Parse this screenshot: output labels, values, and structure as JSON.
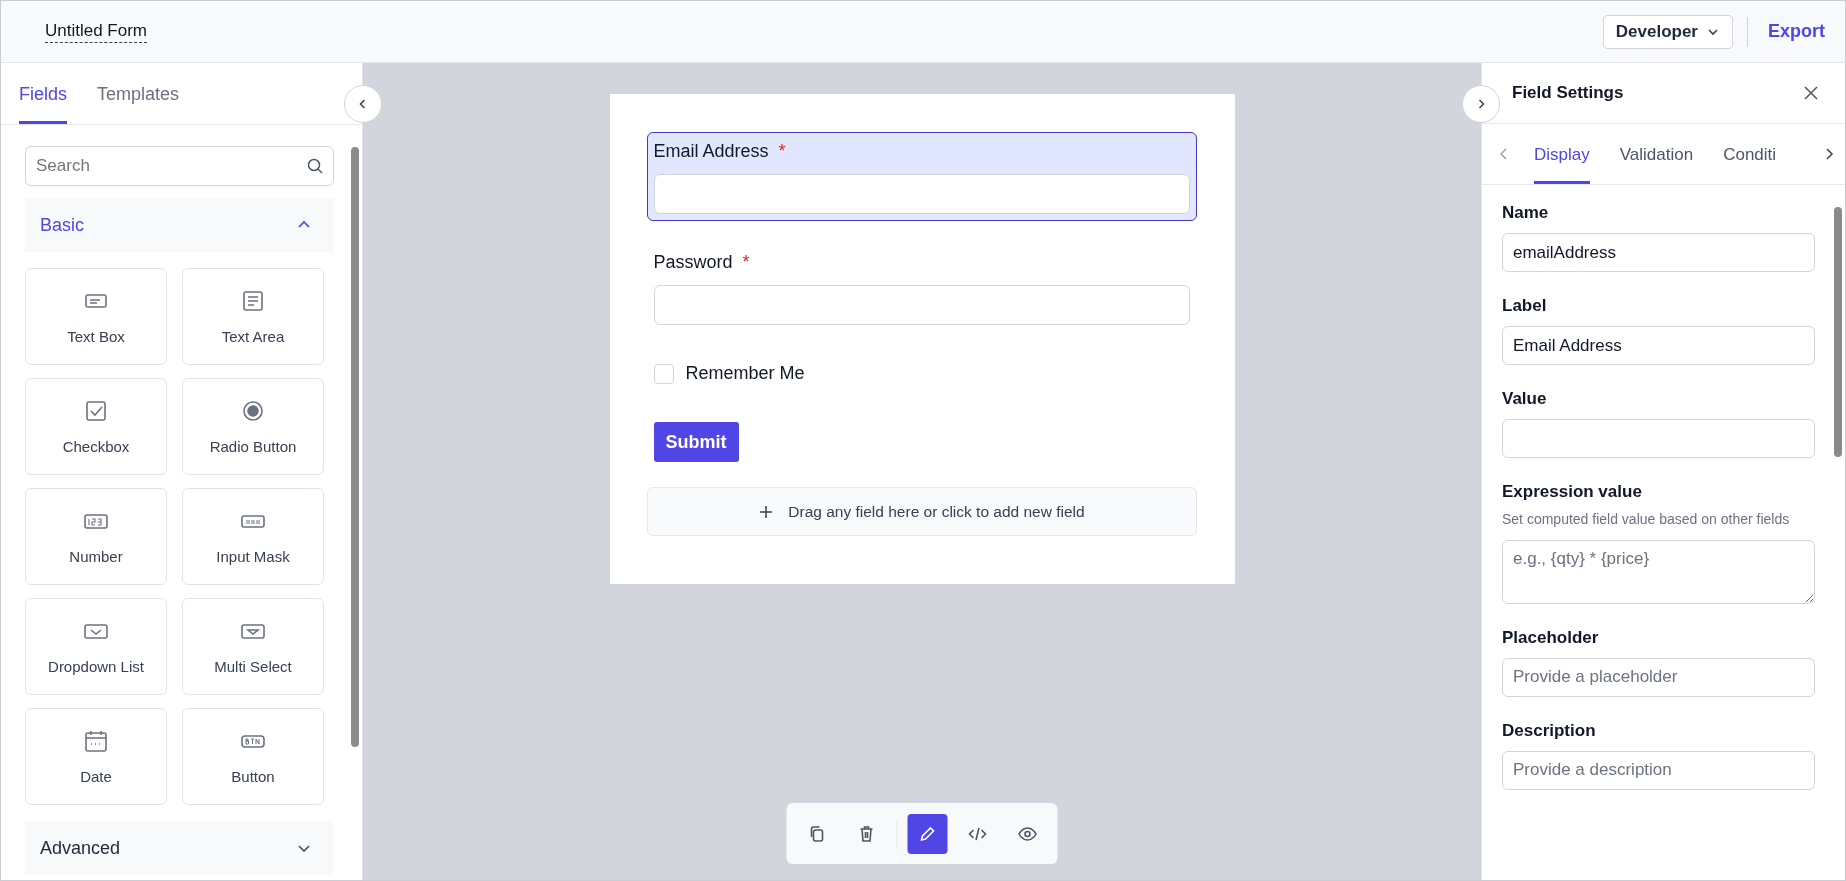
{
  "header": {
    "title": "Untitled Form",
    "mode": "Developer",
    "export": "Export"
  },
  "left_panel": {
    "tabs": [
      {
        "label": "Fields",
        "selected": true
      },
      {
        "label": "Templates",
        "selected": false
      }
    ],
    "search": {
      "placeholder": "Search"
    },
    "groups": [
      {
        "title": "Basic",
        "expanded": true,
        "items": [
          {
            "label": "Text Box",
            "kind": "textbox"
          },
          {
            "label": "Text Area",
            "kind": "textarea"
          },
          {
            "label": "Checkbox",
            "kind": "checkbox"
          },
          {
            "label": "Radio Button",
            "kind": "radio"
          },
          {
            "label": "Number",
            "kind": "number"
          },
          {
            "label": "Input Mask",
            "kind": "mask"
          },
          {
            "label": "Dropdown List",
            "kind": "dropdown"
          },
          {
            "label": "Multi Select",
            "kind": "multiselect"
          },
          {
            "label": "Date",
            "kind": "date"
          },
          {
            "label": "Button",
            "kind": "button"
          }
        ]
      },
      {
        "title": "Advanced",
        "expanded": false
      }
    ]
  },
  "form": {
    "fields": [
      {
        "kind": "input",
        "label": "Email Address",
        "required": "*",
        "selected": true
      },
      {
        "kind": "input",
        "label": "Password",
        "required": "*",
        "selected": false
      },
      {
        "kind": "checkbox",
        "label": "Remember Me",
        "checked": false,
        "selected": false
      },
      {
        "kind": "button",
        "label": "Submit",
        "selected": false
      }
    ],
    "drop_zone": "Drag any field here or click to add new field"
  },
  "toolbar": [
    {
      "kind": "copy",
      "selected": false
    },
    {
      "kind": "delete",
      "selected": false
    },
    {
      "kind": "edit",
      "selected": true
    },
    {
      "kind": "code",
      "selected": false
    },
    {
      "kind": "preview",
      "selected": false
    }
  ],
  "settings": {
    "title": "Field Settings",
    "tabs": [
      {
        "label": "Display",
        "selected": true
      },
      {
        "label": "Validation",
        "selected": false
      },
      {
        "label": "Conditi",
        "selected": false
      }
    ],
    "fields": [
      {
        "kind": "input",
        "label": "Name",
        "value": "emailAddress"
      },
      {
        "kind": "input",
        "label": "Label",
        "value": "Email Address"
      },
      {
        "kind": "input",
        "label": "Value"
      },
      {
        "kind": "textarea",
        "label": "Expression value",
        "hint": "Set computed field value based on other fields",
        "placeholder": "e.g., {qty} * {price}"
      },
      {
        "kind": "input",
        "label": "Placeholder",
        "placeholder": "Provide a placeholder"
      },
      {
        "kind": "input",
        "label": "Description",
        "placeholder": "Provide a description"
      }
    ]
  }
}
